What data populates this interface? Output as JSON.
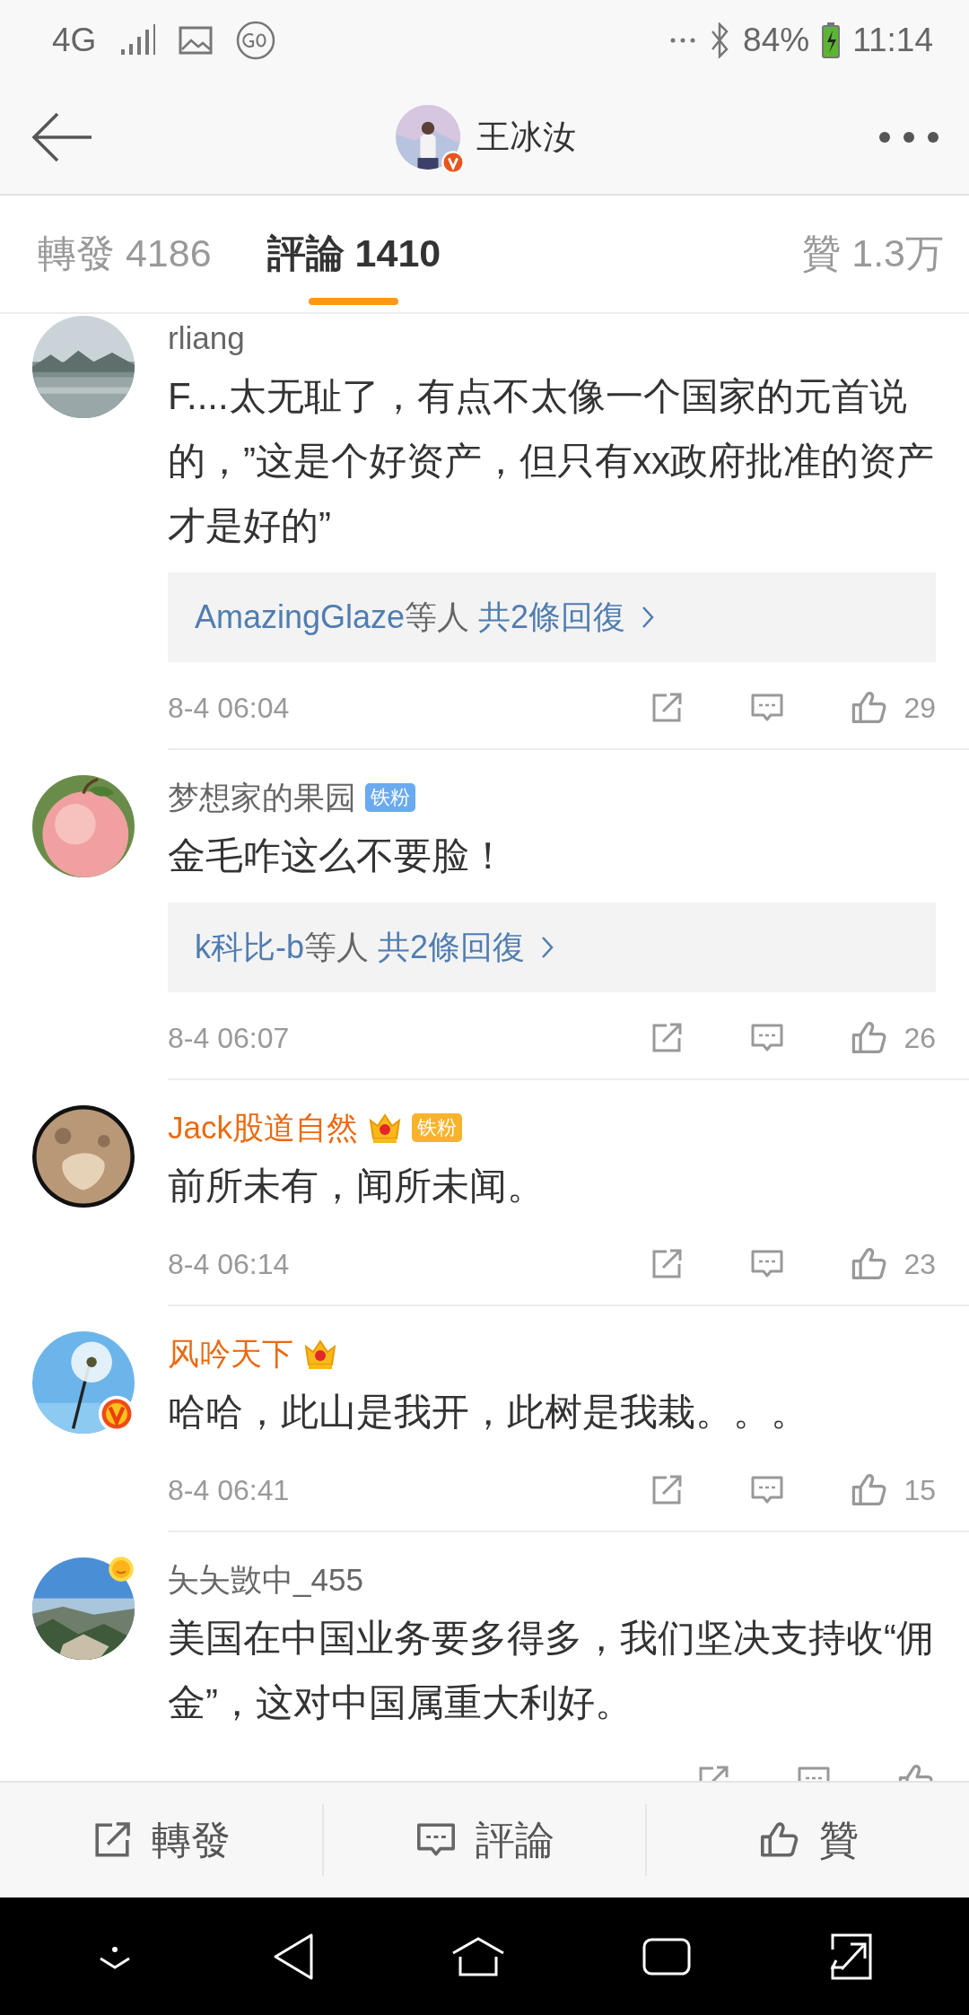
{
  "status_bar": {
    "network": "4G",
    "battery": "84%",
    "time": "11:14"
  },
  "header": {
    "title": "王冰汝",
    "avatar_badge": {
      "kind": "verified"
    }
  },
  "tabs": [
    {
      "label": "轉發 4186",
      "selected": false
    },
    {
      "label": "評論 1410",
      "selected": true
    },
    {
      "label": "贊 1.3万",
      "selected": false
    }
  ],
  "comments": [
    {
      "user": {
        "name": "rliang",
        "vip": false
      },
      "text": "F....太无耻了，有点不太像一个国家的元首说的，”这是个好资产，但只有xx政府批准的资产才是好的”",
      "replies": {
        "names": "AmazingGlaze",
        "suffix": "等人",
        "count": "共2條回復"
      },
      "time": "8-4 06:04",
      "likes": "29"
    },
    {
      "user": {
        "name": "梦想家的果园",
        "vip": false,
        "badges": [
          {
            "kind": "fan",
            "label": "铁粉",
            "color": "#6aaaf0"
          }
        ]
      },
      "text": "金毛咋这么不要脸！",
      "replies": {
        "names": "k科比-b",
        "suffix": "等人",
        "count": "共2條回復"
      },
      "time": "8-4 06:07",
      "likes": "26"
    },
    {
      "user": {
        "name": "Jack股道自然",
        "vip": true,
        "badges": [
          {
            "kind": "crown"
          },
          {
            "kind": "fan",
            "label": "铁粉",
            "color": "#f7b32b"
          }
        ]
      },
      "text": "前所未有，闻所未闻。",
      "time": "8-4 06:14",
      "likes": "23"
    },
    {
      "user": {
        "name": "风吟天下",
        "vip": true,
        "avatar_badge": {
          "kind": "gold"
        },
        "badges": [
          {
            "kind": "crown"
          }
        ]
      },
      "text": "哈哈，此山是我开，此树是我栽。。。",
      "time": "8-4 06:41",
      "likes": "15"
    },
    {
      "user": {
        "name": "夨夨敳中_455",
        "vip": false,
        "avatar_badge": {
          "kind": "sun"
        }
      },
      "text": "美国在中国业务要多得多，我们坚决支持收“佣金”，这对中国属重大利好。"
    }
  ],
  "bottom_bar": [
    {
      "kind": "share",
      "label": "轉發"
    },
    {
      "kind": "comment",
      "label": "評論"
    },
    {
      "kind": "like",
      "label": "贊"
    }
  ]
}
